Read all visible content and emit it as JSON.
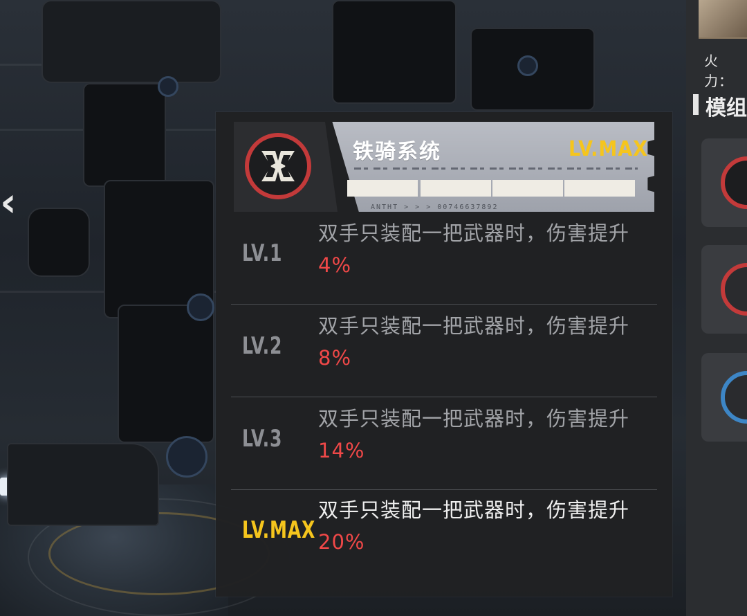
{
  "skill": {
    "name": "铁骑系统",
    "level_badge": "LV.MAX",
    "serial": "ANTHT > > > 00746637892"
  },
  "levels": [
    {
      "label": "LV.1",
      "desc": "双手只装配一把武器时，伤害提升",
      "value": "4%"
    },
    {
      "label": "LV.2",
      "desc": "双手只装配一把武器时，伤害提升",
      "value": "8%"
    },
    {
      "label": "LV.3",
      "desc": "双手只装配一把武器时，伤害提升",
      "value": "14%"
    },
    {
      "label": "LV.MAX",
      "desc": "双手只装配一把武器时，伤害提升",
      "value": "20%"
    }
  ],
  "side_panel": {
    "stat_label": "火力：",
    "section_label": "模组"
  },
  "colors": {
    "accent_gold": "#f5c51d",
    "value_red": "#f04848",
    "icon_ring": "#c33a3a",
    "slot_ring_blue": "#3d86c6"
  },
  "icons": {
    "skill_icon": "iron-rider-emblem-icon",
    "back": "chevron-left-icon"
  }
}
